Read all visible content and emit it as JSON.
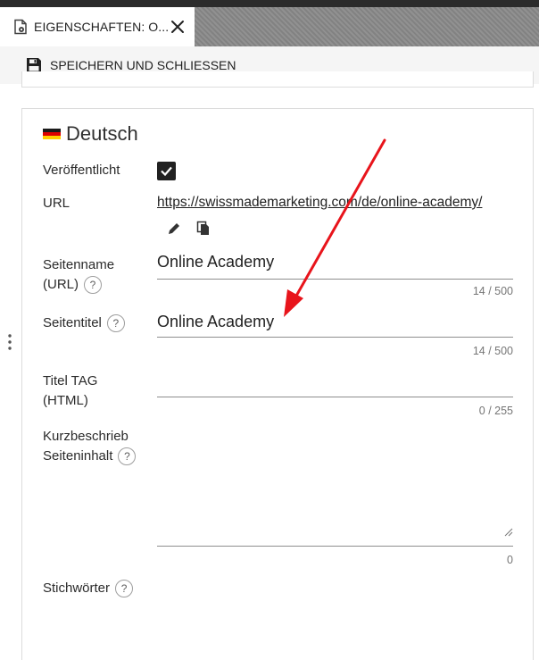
{
  "tab": {
    "label": "EIGENSCHAFTEN: O...",
    "icon": "page-settings-icon",
    "close_icon": "close-icon"
  },
  "toolbar": {
    "save_close_label": "SPEICHERN UND SCHLIESSEN",
    "save_icon": "floppy-disk-icon"
  },
  "section": {
    "language": "Deutsch",
    "flag_colors": [
      "#1a1a1a",
      "#dd0000",
      "#ffce00"
    ]
  },
  "fields": {
    "published": {
      "label": "Veröffentlicht",
      "checked": true
    },
    "url": {
      "label": "URL",
      "value": "https://swissmademarketing.com/de/online-academy/",
      "actions": [
        "edit-pencil-icon",
        "copy-icon"
      ]
    },
    "page_name": {
      "label_line1": "Seitenname",
      "label_line2": "(URL)",
      "value": "Online Academy",
      "counter": "14 / 500"
    },
    "page_title": {
      "label": "Seitentitel",
      "value": "Online Academy",
      "counter": "14 / 500"
    },
    "title_tag": {
      "label_line1": "Titel TAG",
      "label_line2": "(HTML)",
      "value": "",
      "counter": "0 / 255"
    },
    "short_description": {
      "label_line1": "Kurzbeschrieb",
      "label_line2": "Seiteninhalt",
      "value": "",
      "counter": "0"
    },
    "keywords": {
      "label": "Stichwörter"
    }
  },
  "help_glyph": "?",
  "annotation_color": "#e8141b"
}
